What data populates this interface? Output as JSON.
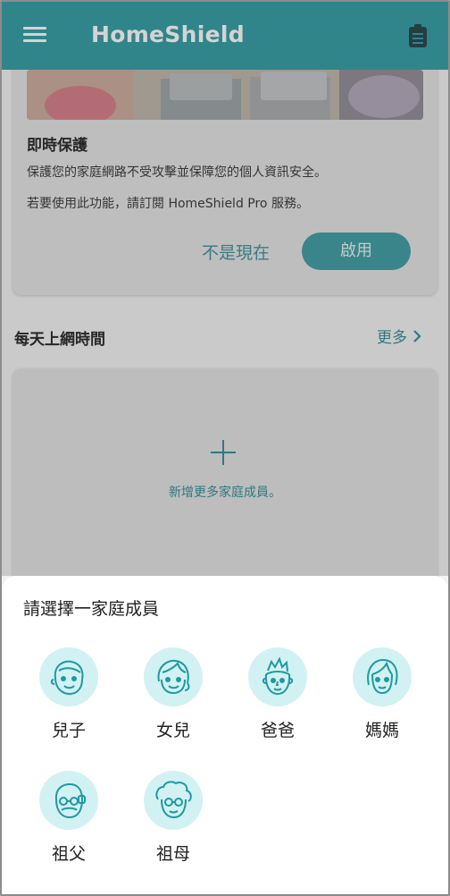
{
  "app_bar": {
    "title": "HomeShield",
    "menu_icon": "hamburger-menu-icon",
    "action_icon": "clipboard-icon"
  },
  "protection_card": {
    "heading": "即時保護",
    "description_1": "保護您的家庭網路不受攻擊並保障您的個人資訊安全。",
    "description_2": "若要使用此功能，請訂閱 HomeShield Pro 服務。",
    "not_now_label": "不是現在",
    "enable_label": "啟用"
  },
  "daily_online": {
    "title": "每天上網時間",
    "more_label": "更多",
    "add_member_label": "新增更多家庭成員。"
  },
  "sheet": {
    "title": "請選擇一家庭成員",
    "members": [
      {
        "label": "兒子",
        "icon": "son-avatar-icon"
      },
      {
        "label": "女兒",
        "icon": "daughter-avatar-icon"
      },
      {
        "label": "爸爸",
        "icon": "father-avatar-icon"
      },
      {
        "label": "媽媽",
        "icon": "mother-avatar-icon"
      },
      {
        "label": "祖父",
        "icon": "grandfather-avatar-icon"
      },
      {
        "label": "祖母",
        "icon": "grandmother-avatar-icon"
      }
    ]
  },
  "colors": {
    "brand": "#2e9aa1",
    "accent_text": "#2e8a91",
    "avatar_bg": "#d2f1f3"
  }
}
